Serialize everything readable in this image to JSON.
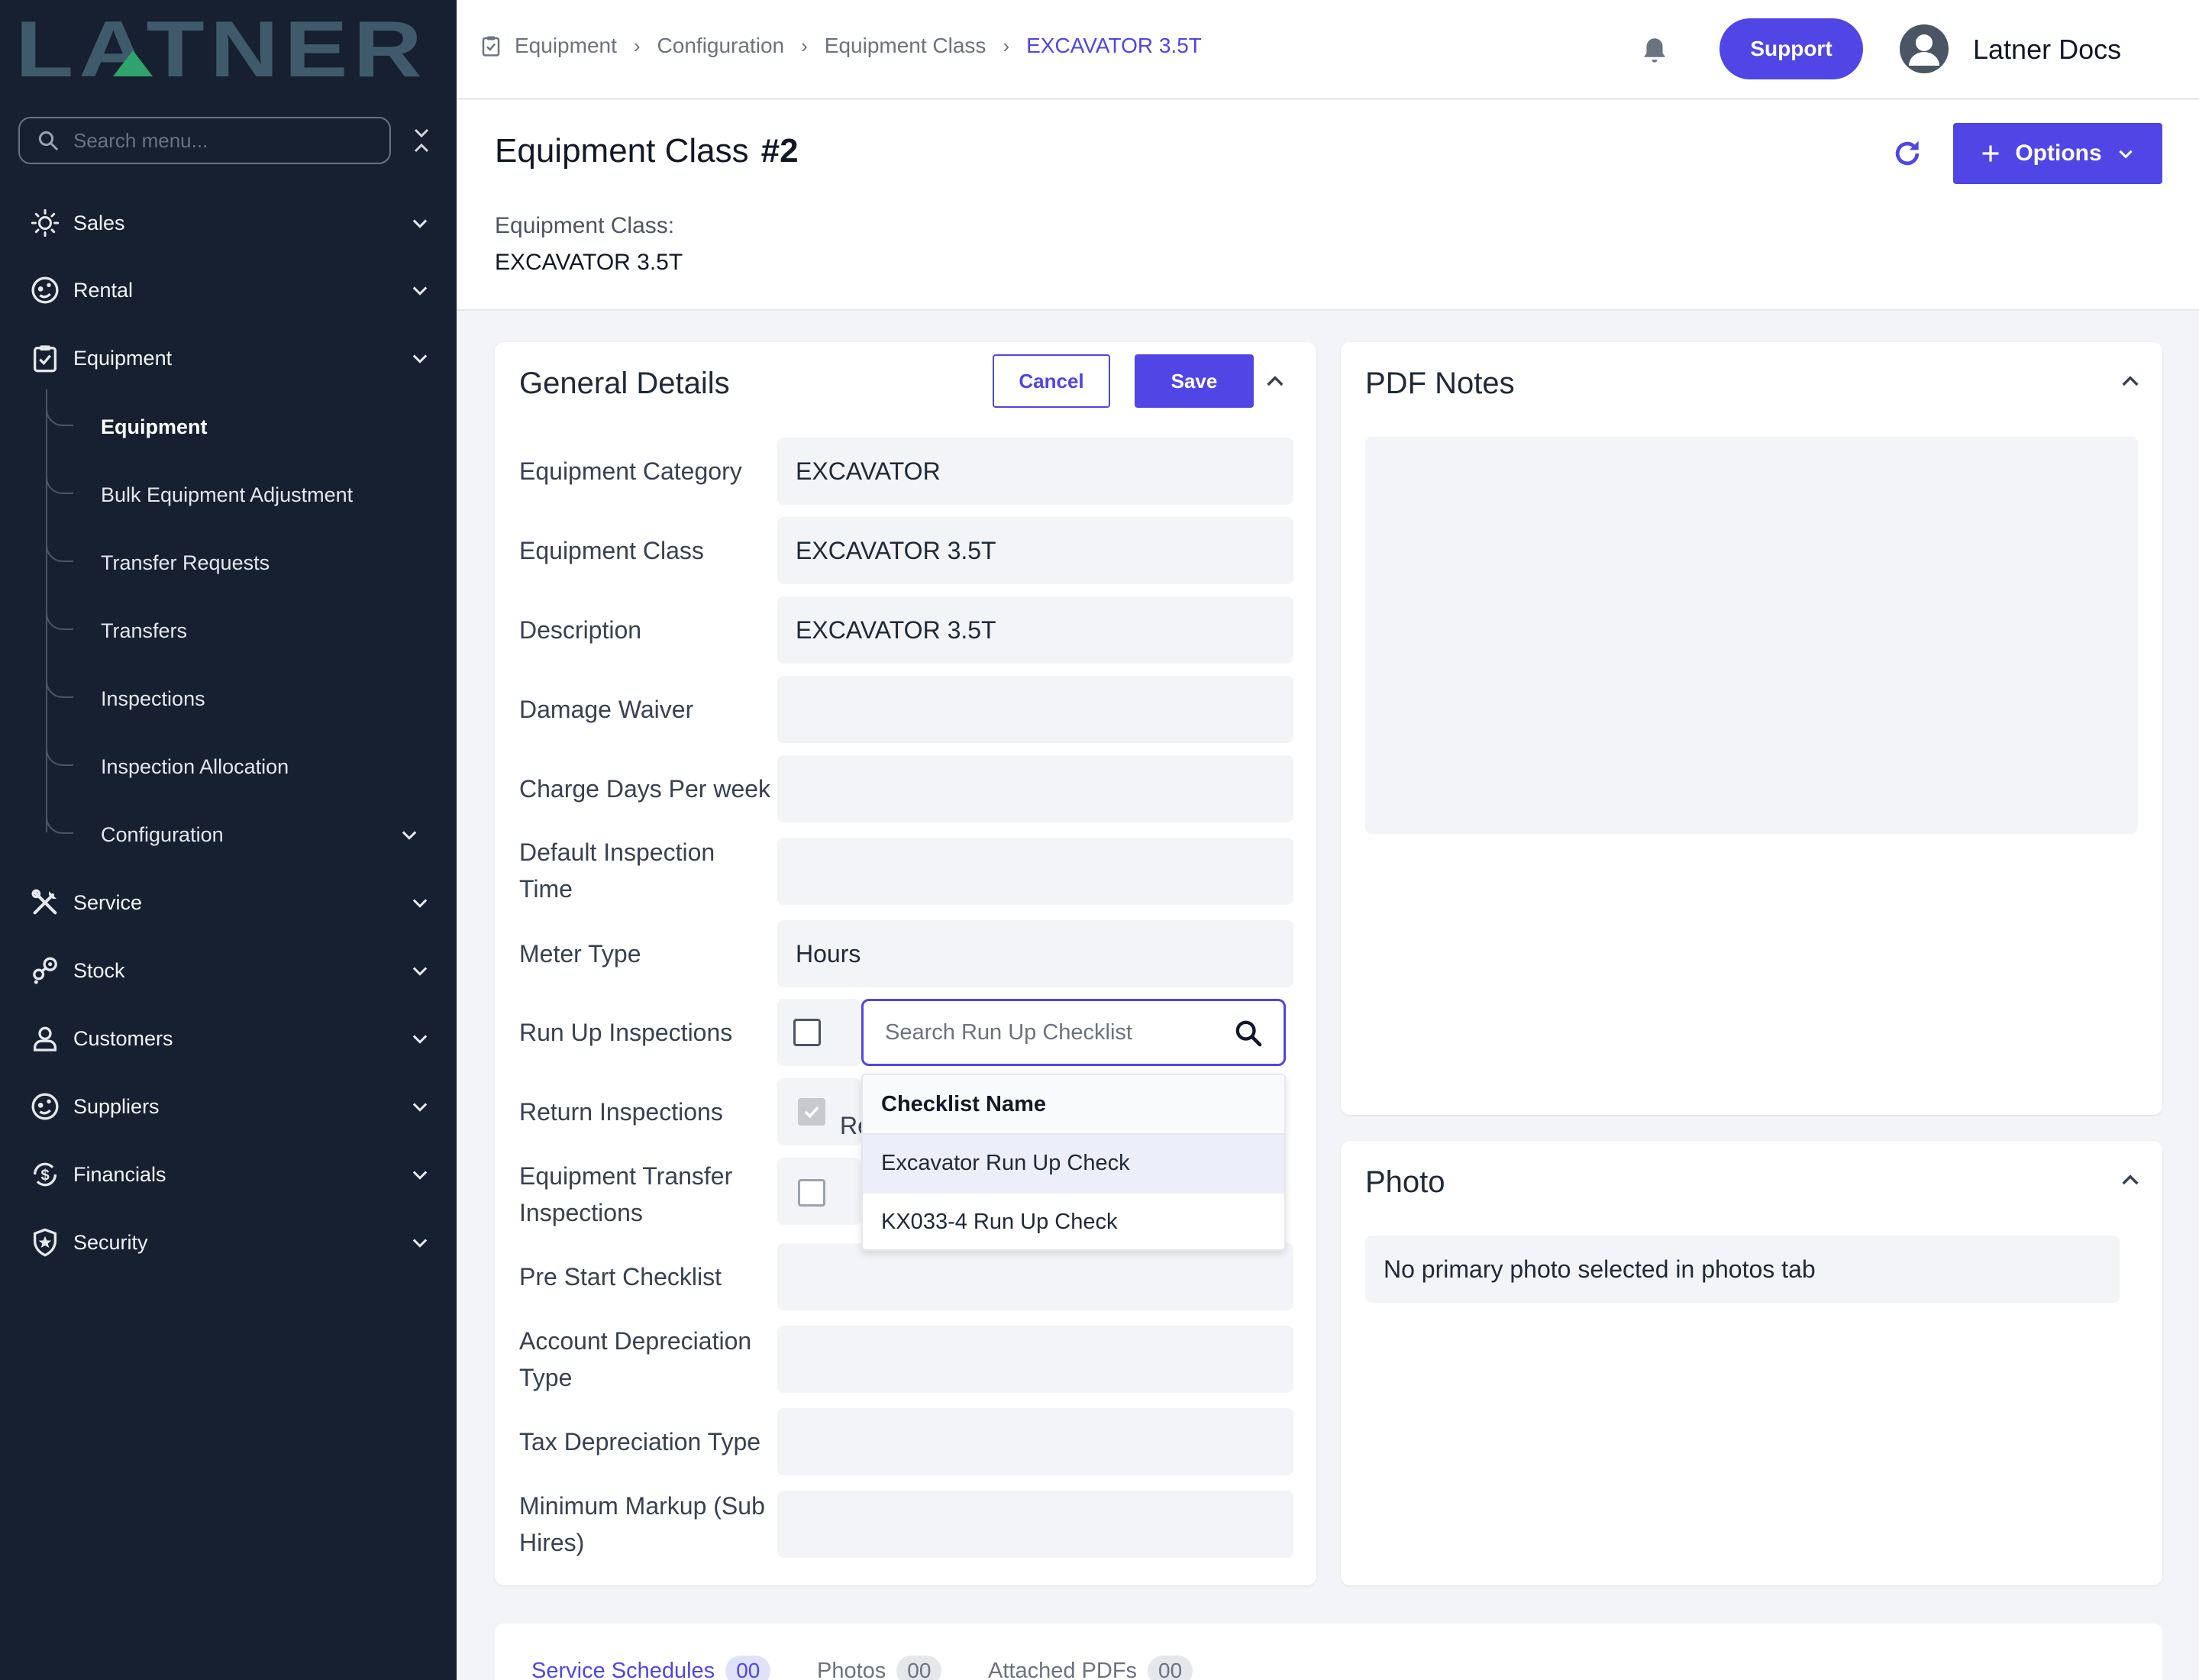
{
  "brand": {
    "logo_text": "LATNER",
    "accent_color": "#4f46e5",
    "logo_color": "#3e5a6b",
    "logo_accent": "#2fa36b"
  },
  "sidebar": {
    "search_placeholder": "Search menu...",
    "items": [
      {
        "label": "Sales",
        "icon": "sales-icon"
      },
      {
        "label": "Rental",
        "icon": "rental-icon"
      },
      {
        "label": "Equipment",
        "icon": "clipboard-icon"
      },
      {
        "label": "Service",
        "icon": "tools-icon"
      },
      {
        "label": "Stock",
        "icon": "stock-icon"
      },
      {
        "label": "Customers",
        "icon": "user-icon"
      },
      {
        "label": "Suppliers",
        "icon": "suppliers-icon"
      },
      {
        "label": "Financials",
        "icon": "dollar-icon"
      },
      {
        "label": "Security",
        "icon": "shield-icon"
      }
    ],
    "equipment_sub": [
      "Equipment",
      "Bulk Equipment Adjustment",
      "Transfer Requests",
      "Transfers",
      "Inspections",
      "Inspection Allocation",
      "Configuration"
    ]
  },
  "topbar": {
    "breadcrumb": [
      "Equipment",
      "Configuration",
      "Equipment Class",
      "EXCAVATOR 3.5T"
    ],
    "support_label": "Support",
    "user_name": "Latner Docs"
  },
  "header": {
    "title": "Equipment Class",
    "number": "#2",
    "options_label": "Options",
    "class_label": "Equipment Class:",
    "class_value": "EXCAVATOR 3.5T"
  },
  "general": {
    "title": "General Details",
    "cancel_label": "Cancel",
    "save_label": "Save",
    "fields": {
      "category": {
        "label": "Equipment Category",
        "value": "EXCAVATOR"
      },
      "class": {
        "label": "Equipment Class",
        "value": "EXCAVATOR 3.5T"
      },
      "description": {
        "label": "Description",
        "value": "EXCAVATOR 3.5T"
      },
      "damage_waiver": {
        "label": "Damage Waiver",
        "value": ""
      },
      "charge_days": {
        "label": "Charge Days Per week",
        "value": ""
      },
      "inspection_time": {
        "label": "Default Inspection Time",
        "value": ""
      },
      "meter_type": {
        "label": "Meter Type",
        "value": "Hours"
      },
      "run_up": {
        "label": "Run Up Inspections",
        "checked": false
      },
      "return": {
        "label": "Return Inspections",
        "checked": true,
        "partial_text": "Re"
      },
      "transfer": {
        "label": "Equipment Transfer Inspections",
        "checked": false
      },
      "pre_start": {
        "label": "Pre Start Checklist",
        "value": ""
      },
      "account_dep": {
        "label": "Account Depreciation Type",
        "value": ""
      },
      "tax_dep": {
        "label": "Tax Depreciation Type",
        "value": ""
      },
      "min_markup": {
        "label": "Minimum Markup (Sub Hires)",
        "value": ""
      }
    },
    "run_up_search_placeholder": "Search Run Up Checklist",
    "dropdown": {
      "header": "Checklist Name",
      "options": [
        "Excavator Run Up Check",
        "KX033-4 Run Up Check"
      ]
    }
  },
  "pdf_notes": {
    "title": "PDF Notes"
  },
  "photo": {
    "title": "Photo",
    "message": "No primary photo selected in photos tab"
  },
  "tabs": [
    {
      "label": "Service Schedules",
      "count": "00"
    },
    {
      "label": "Photos",
      "count": "00"
    },
    {
      "label": "Attached PDFs",
      "count": "00"
    }
  ]
}
